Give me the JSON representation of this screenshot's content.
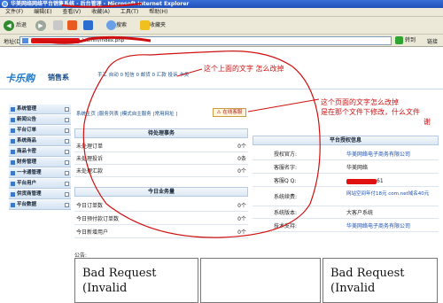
{
  "window": {
    "title": "华美网络网络平台销售系统 - 后台管理 - Microsoft Internet Explorer"
  },
  "menu": [
    "文件(F)",
    "编辑(E)",
    "查看(V)",
    "收藏(A)",
    "工具(T)",
    "帮助(H)"
  ],
  "toolbar": {
    "back": "后退",
    "search": "搜索",
    "favorites": "收藏夹"
  },
  "address": {
    "label": "地址(D)",
    "url": "/admin/index.php",
    "go": "转到",
    "links": "链接"
  },
  "header": {
    "logo": "卡乐购",
    "logo_sub": "销售系",
    "nav": "手工 自动 0 短信 0 邮货 0 汇款 投诉 卡类"
  },
  "sidebar": {
    "items": [
      "系统管理",
      "新闻公告",
      "平台订单",
      "系统商品",
      "商品卡密",
      "财务管理",
      "一卡通管理",
      "平台用户",
      "供货商管理",
      "平台数据"
    ]
  },
  "tabs": {
    "items": [
      "系统主页",
      "|服务列表",
      "|模式自主服务",
      "|常用网址",
      "|"
    ],
    "alert": "⚠ 在线客服"
  },
  "pending": {
    "title": "待处理事务",
    "rows": [
      {
        "label": "未处理订单",
        "value": "0个"
      },
      {
        "label": "未处理投诉",
        "value": "0条"
      },
      {
        "label": "未处理汇款",
        "value": "0个"
      }
    ]
  },
  "today": {
    "title": "今日业务量",
    "rows": [
      {
        "label": "今日订单数",
        "value": "0个"
      },
      {
        "label": "今日预付款订单数",
        "value": "0个"
      },
      {
        "label": "今日新增用户",
        "value": "0个"
      }
    ]
  },
  "info": {
    "title": "平台授权信息",
    "rows": [
      {
        "key": "授权官方:",
        "value": "华美网络电子商务有限公司",
        "blue": true
      },
      {
        "key": "客服名字:",
        "value": "华美网络",
        "blue": false
      },
      {
        "key": "客服Q Q:",
        "value": "61",
        "blue": false
      },
      {
        "key": "系统续费:",
        "value": "网站空间年付18元 com.net域名40元",
        "blue": true
      },
      {
        "key": "系统版本:",
        "value": "大客户系统",
        "blue": false
      },
      {
        "key": "技术支持:",
        "value": "华美网络电子商务有限公司",
        "blue": true
      }
    ]
  },
  "notice": {
    "label": "公告:"
  },
  "frames": {
    "left": "Bad Request (Invalid",
    "right": "Bad Request (Invalid"
  },
  "annotations": {
    "top": "这个上面的文字 怎么改掉",
    "right_line1": "这个页面的文字怎么改掉",
    "right_line2": "是在那个文件下修改，什么文件",
    "right_line3": "谢"
  },
  "colors": {
    "annotation": "#d01010",
    "title_bar": "#1f4fb8"
  }
}
